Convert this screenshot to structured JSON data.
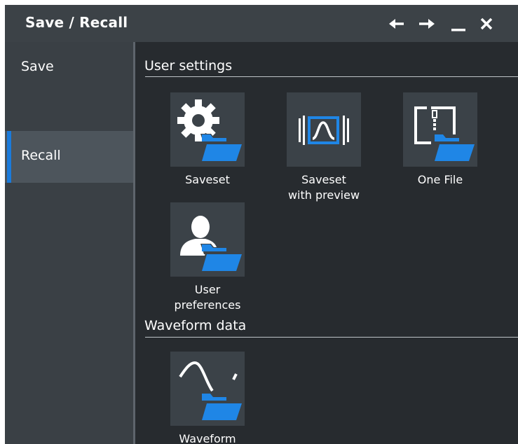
{
  "window": {
    "title": "Save / Recall"
  },
  "sidebar": {
    "items": [
      {
        "label": "Save"
      },
      {
        "label": "Recall"
      }
    ]
  },
  "sections": {
    "user_settings": {
      "title": "User settings",
      "tiles": [
        {
          "label": "Saveset",
          "icon": "gear-folder-icon"
        },
        {
          "label1": "Saveset",
          "label2": "with preview",
          "icon": "saveset-preview-folder-icon"
        },
        {
          "label": "One File",
          "icon": "file-folder-icon"
        },
        {
          "label1": "User",
          "label2": "preferences",
          "icon": "user-folder-icon"
        }
      ]
    },
    "waveform_data": {
      "title": "Waveform data",
      "tiles": [
        {
          "label": "Waveform",
          "icon": "waveform-folder-icon"
        }
      ]
    }
  },
  "colors": {
    "accent": "#1a7bdc",
    "folder": "#1f86e6",
    "titlebar": "#3c4247",
    "background": "#2b2f33"
  }
}
